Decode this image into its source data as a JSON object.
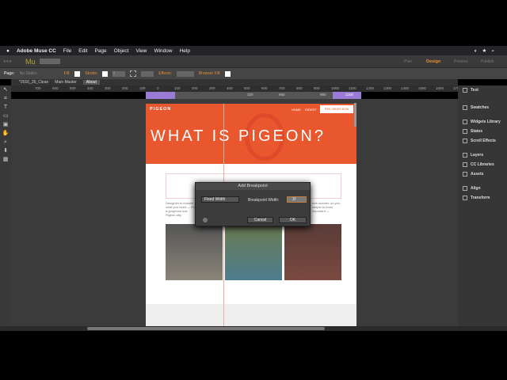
{
  "menu": {
    "app": "Adobe Muse CC",
    "items": [
      "File",
      "Edit",
      "Page",
      "Object",
      "View",
      "Window",
      "Help"
    ]
  },
  "app_toolbar": {
    "logo": "Mu",
    "modes": [
      "Plan",
      "Design",
      "Preview",
      "Publish"
    ],
    "accent": "#e7902e"
  },
  "control_bar": {
    "page_label": "Page:",
    "page_value": "No States",
    "fill": "Fill:",
    "stroke": "Stroke:",
    "stroke_value": "0",
    "effects": "Effects:",
    "browser_fill": "Browser Fill:"
  },
  "tabs": [
    "*2016_26_Clean",
    "Main Master",
    "About"
  ],
  "ruler": [
    "700",
    "600",
    "500",
    "400",
    "300",
    "200",
    "100",
    "0",
    "100",
    "200",
    "300",
    "400",
    "500",
    "600",
    "700",
    "800",
    "900",
    "1000",
    "1100",
    "1200",
    "1300",
    "1400",
    "1500",
    "1600",
    "1700"
  ],
  "breakpoints": {
    "a": "320",
    "b": "960",
    "c": "990",
    "d": "1200"
  },
  "site": {
    "logo": "PIGEON",
    "nav": [
      "HOME",
      "RIDERT"
    ],
    "cta": "PRE-ORDER NOW",
    "hero": "WHAT IS PIGEON?",
    "body_left": "Designed to include what you need — it's a gorgeous sca Pigeon ally.",
    "body_right": "sick scooter, so you, simple to most important — ",
    "hero_color": "#e8572d"
  },
  "dialog": {
    "title": "Add Breakpoint",
    "mode": "Fixed Width",
    "width_label": "Breakpoint Width:",
    "width_value": "1f",
    "cancel": "Cancel",
    "ok": "OK"
  },
  "panels": [
    "Text",
    "Swatches",
    "Widgets Library",
    "States",
    "Scroll Effects",
    "Layers",
    "CC Libraries",
    "Assets",
    "Align",
    "Transform"
  ]
}
